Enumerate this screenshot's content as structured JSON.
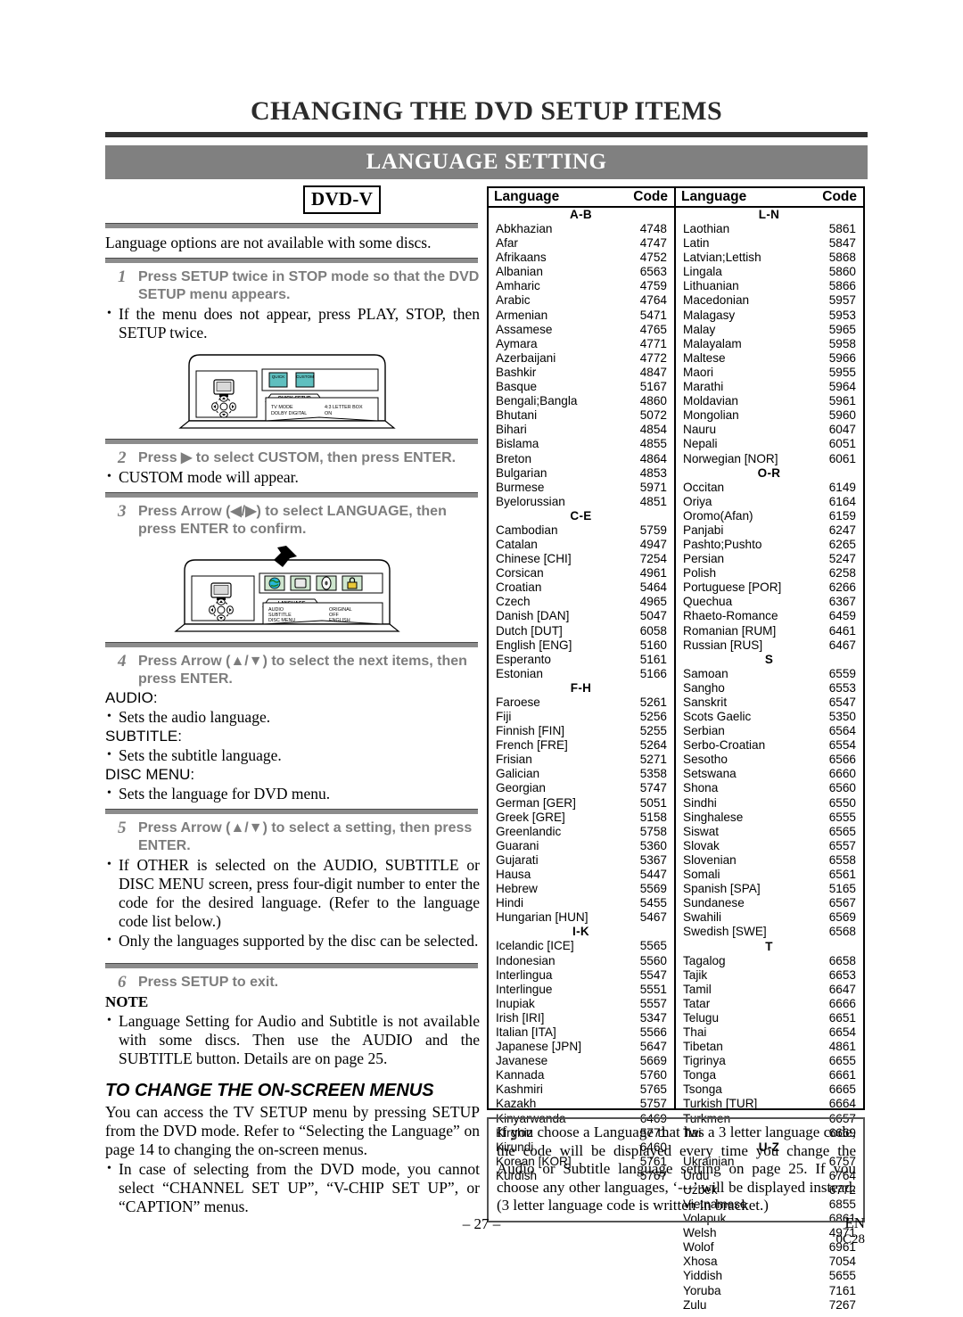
{
  "header": {
    "title": "CHANGING THE DVD SETUP ITEMS",
    "banner": "LANGUAGE SETTING"
  },
  "badge": {
    "label": "DVD-V"
  },
  "intro": "Language options are not available with some discs.",
  "steps": {
    "step1": {
      "num": "1",
      "text": "Press SETUP twice in STOP mode so that the DVD SETUP menu appears."
    },
    "step1_bullet": "If the menu does not appear, press PLAY, STOP, then SETUP twice.",
    "step2": {
      "num": "2",
      "text": "Press ▶ to select CUSTOM, then press ENTER."
    },
    "step2_bullet": "CUSTOM mode will appear.",
    "step3": {
      "num": "3",
      "text": "Press Arrow (◀/▶) to select LANGUAGE, then press ENTER to confirm."
    },
    "step4": {
      "num": "4",
      "text": "Press Arrow (▲/▼) to select the next items, then press ENTER."
    },
    "step5": {
      "num": "5",
      "text": "Press Arrow (▲/▼) to select a setting, then press ENTER."
    },
    "step5_bullet1": "If OTHER is selected on the AUDIO, SUBTITLE or DISC MENU screen, press four-digit number to enter the code for the desired language. (Refer to the language code list below.)",
    "step5_bullet2": "Only the languages supported by the disc can be selected.",
    "step6": {
      "num": "6",
      "text": "Press SETUP to exit."
    }
  },
  "items": {
    "audio_label": "AUDIO:",
    "audio_desc": "Sets the audio language.",
    "subtitle_label": "SUBTITLE:",
    "subtitle_desc": "Sets the subtitle language.",
    "discmenu_label": "DISC MENU:",
    "discmenu_desc": "Sets the language for DVD menu."
  },
  "note": {
    "heading": "NOTE",
    "text": "Language Setting for Audio and Subtitle is not available with some discs. Then use the AUDIO and the SUBTITLE button. Details are on page 25."
  },
  "onscreen": {
    "heading": "TO CHANGE THE ON-SCREEN MENUS",
    "paragraph": "You can access the TV SETUP menu by pressing SETUP from the DVD mode. Refer to “Selecting the Language” on page 14 to changing the on-screen menus.",
    "bullet": "In case of selecting from the DVD mode, you cannot select “CHANNEL SET UP”, “V-CHIP SET UP”, or “CAPTION” menus."
  },
  "diagram1": {
    "tab_label": "QUICK SETUP",
    "icon1": "QUICK",
    "icon2": "CUSTOM",
    "row1_label": "TV MODE",
    "row1_value": "4:3 LETTER BOX",
    "row2_label": "DOLBY DIGITAL",
    "row2_value": "ON"
  },
  "diagram2": {
    "tab_label": "LANGUAGE",
    "row1_label": "AUDIO",
    "row1_value": "ORIGINAL",
    "row2_label": "SUBTITLE",
    "row2_value": "OFF",
    "row3_label": "DISC MENU",
    "row3_value": "ENGLISH"
  },
  "table": {
    "col_language": "Language",
    "col_code": "Code",
    "left_groups": [
      {
        "group": "A-B",
        "rows": [
          [
            "Abkhazian",
            "4748"
          ],
          [
            "Afar",
            "4747"
          ],
          [
            "Afrikaans",
            "4752"
          ],
          [
            "Albanian",
            "6563"
          ],
          [
            "Amharic",
            "4759"
          ],
          [
            "Arabic",
            "4764"
          ],
          [
            "Armenian",
            "5471"
          ],
          [
            "Assamese",
            "4765"
          ],
          [
            "Aymara",
            "4771"
          ],
          [
            "Azerbaijani",
            "4772"
          ],
          [
            "Bashkir",
            "4847"
          ],
          [
            "Basque",
            "5167"
          ],
          [
            "Bengali;Bangla",
            "4860"
          ],
          [
            "Bhutani",
            "5072"
          ],
          [
            "Bihari",
            "4854"
          ],
          [
            "Bislama",
            "4855"
          ],
          [
            "Breton",
            "4864"
          ],
          [
            "Bulgarian",
            "4853"
          ],
          [
            "Burmese",
            "5971"
          ],
          [
            "Byelorussian",
            "4851"
          ]
        ]
      },
      {
        "group": "C-E",
        "rows": [
          [
            "Cambodian",
            "5759"
          ],
          [
            "Catalan",
            "4947"
          ],
          [
            "Chinese [CHI]",
            "7254"
          ],
          [
            "Corsican",
            "4961"
          ],
          [
            "Croatian",
            "5464"
          ],
          [
            "Czech",
            "4965"
          ],
          [
            "Danish [DAN]",
            "5047"
          ],
          [
            "Dutch [DUT]",
            "6058"
          ],
          [
            "English [ENG]",
            "5160"
          ],
          [
            "Esperanto",
            "5161"
          ],
          [
            "Estonian",
            "5166"
          ]
        ]
      },
      {
        "group": "F-H",
        "rows": [
          [
            "Faroese",
            "5261"
          ],
          [
            "Fiji",
            "5256"
          ],
          [
            "Finnish [FIN]",
            "5255"
          ],
          [
            "French [FRE]",
            "5264"
          ],
          [
            "Frisian",
            "5271"
          ],
          [
            "Galician",
            "5358"
          ],
          [
            "Georgian",
            "5747"
          ],
          [
            "German [GER]",
            "5051"
          ],
          [
            "Greek [GRE]",
            "5158"
          ],
          [
            "Greenlandic",
            "5758"
          ],
          [
            "Guarani",
            "5360"
          ],
          [
            "Gujarati",
            "5367"
          ],
          [
            "Hausa",
            "5447"
          ],
          [
            "Hebrew",
            "5569"
          ],
          [
            "Hindi",
            "5455"
          ],
          [
            "Hungarian [HUN]",
            "5467"
          ]
        ]
      },
      {
        "group": "I-K",
        "rows": [
          [
            "Icelandic [ICE]",
            "5565"
          ],
          [
            "Indonesian",
            "5560"
          ],
          [
            "Interlingua",
            "5547"
          ],
          [
            "Interlingue",
            "5551"
          ],
          [
            "Inupiak",
            "5557"
          ],
          [
            "Irish [IRI]",
            "5347"
          ],
          [
            "Italian [ITA]",
            "5566"
          ],
          [
            "Japanese [JPN]",
            "5647"
          ],
          [
            "Javanese",
            "5669"
          ],
          [
            "Kannada",
            "5760"
          ],
          [
            "Kashmiri",
            "5765"
          ],
          [
            "Kazakh",
            "5757"
          ],
          [
            "Kinyarwanda",
            "6469"
          ],
          [
            "Kirghiz",
            "5771"
          ],
          [
            "Kirundi",
            "6460"
          ],
          [
            "Korean [KOR]",
            "5761"
          ],
          [
            "Kurdish",
            "5767"
          ]
        ]
      }
    ],
    "right_groups": [
      {
        "group": "L-N",
        "rows": [
          [
            "Laothian",
            "5861"
          ],
          [
            "Latin",
            "5847"
          ],
          [
            "Latvian;Lettish",
            "5868"
          ],
          [
            "Lingala",
            "5860"
          ],
          [
            "Lithuanian",
            "5866"
          ],
          [
            "Macedonian",
            "5957"
          ],
          [
            "Malagasy",
            "5953"
          ],
          [
            "Malay",
            "5965"
          ],
          [
            "Malayalam",
            "5958"
          ],
          [
            "Maltese",
            "5966"
          ],
          [
            "Maori",
            "5955"
          ],
          [
            "Marathi",
            "5964"
          ],
          [
            "Moldavian",
            "5961"
          ],
          [
            "Mongolian",
            "5960"
          ],
          [
            "Nauru",
            "6047"
          ],
          [
            "Nepali",
            "6051"
          ],
          [
            "Norwegian [NOR]",
            "6061"
          ]
        ]
      },
      {
        "group": "O-R",
        "rows": [
          [
            "Occitan",
            "6149"
          ],
          [
            "Oriya",
            "6164"
          ],
          [
            "Oromo(Afan)",
            "6159"
          ],
          [
            "Panjabi",
            "6247"
          ],
          [
            "Pashto;Pushto",
            "6265"
          ],
          [
            "Persian",
            "5247"
          ],
          [
            "Polish",
            "6258"
          ],
          [
            "Portuguese [POR]",
            "6266"
          ],
          [
            "Quechua",
            "6367"
          ],
          [
            "Rhaeto-Romance",
            "6459"
          ],
          [
            "Romanian [RUM]",
            "6461"
          ],
          [
            "Russian [RUS]",
            "6467"
          ]
        ]
      },
      {
        "group": "S",
        "rows": [
          [
            "Samoan",
            "6559"
          ],
          [
            "Sangho",
            "6553"
          ],
          [
            "Sanskrit",
            "6547"
          ],
          [
            "Scots Gaelic",
            "5350"
          ],
          [
            "Serbian",
            "6564"
          ],
          [
            "Serbo-Croatian",
            "6554"
          ],
          [
            "Sesotho",
            "6566"
          ],
          [
            "Setswana",
            "6660"
          ],
          [
            "Shona",
            "6560"
          ],
          [
            "Sindhi",
            "6550"
          ],
          [
            "Singhalese",
            "6555"
          ],
          [
            "Siswat",
            "6565"
          ],
          [
            "Slovak",
            "6557"
          ],
          [
            "Slovenian",
            "6558"
          ],
          [
            "Somali",
            "6561"
          ],
          [
            "Spanish [SPA]",
            "5165"
          ],
          [
            "Sundanese",
            "6567"
          ],
          [
            "Swahili",
            "6569"
          ],
          [
            "Swedish [SWE]",
            "6568"
          ]
        ]
      },
      {
        "group": "T",
        "rows": [
          [
            "Tagalog",
            "6658"
          ],
          [
            "Tajik",
            "6653"
          ],
          [
            "Tamil",
            "6647"
          ],
          [
            "Tatar",
            "6666"
          ],
          [
            "Telugu",
            "6651"
          ],
          [
            "Thai",
            "6654"
          ],
          [
            "Tibetan",
            "4861"
          ],
          [
            "Tigrinya",
            "6655"
          ],
          [
            "Tonga",
            "6661"
          ],
          [
            "Tsonga",
            "6665"
          ],
          [
            "Turkish [TUR]",
            "6664"
          ],
          [
            "Turkmen",
            "6657"
          ],
          [
            "Twi",
            "6669"
          ]
        ]
      },
      {
        "group": "U-Z",
        "rows": [
          [
            "Ukrainian",
            "6757"
          ],
          [
            "Urdu",
            "6764"
          ],
          [
            "Uzbek",
            "6772"
          ],
          [
            "Vietnamese",
            "6855"
          ],
          [
            "Volapuk",
            "6861"
          ],
          [
            "Welsh",
            "4971"
          ],
          [
            "Wolof",
            "6961"
          ],
          [
            "Xhosa",
            "7054"
          ],
          [
            "Yiddish",
            "5655"
          ],
          [
            "Yoruba",
            "7161"
          ],
          [
            "Zulu",
            "7267"
          ]
        ]
      }
    ]
  },
  "bottom_note": "If you choose a Language that has a 3 letter language code, the code will be displayed every time you change the Audio or Subtitle language setting on page 25. If you choose any other languages, ‘---’ will be displayed instead. (3 letter language code is written in bracket.)",
  "footer": {
    "page": "– 27 –",
    "region": "EN",
    "doc_code": "0C28"
  }
}
